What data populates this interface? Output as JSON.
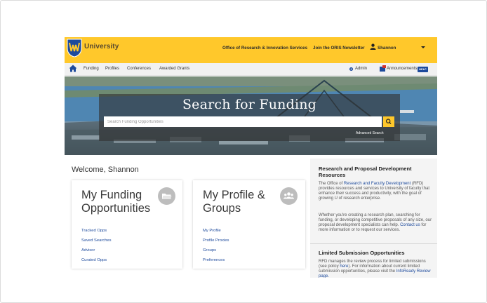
{
  "header": {
    "brand": "University",
    "links": [
      "Office of Research & Innovation Services",
      "Join the ORIS Newsletter"
    ],
    "user_name": "Shannon"
  },
  "nav": {
    "items": [
      "Funding",
      "Profiles",
      "Conferences",
      "Awarded Grants"
    ],
    "admin": "Admin",
    "announcements": "Announcements",
    "help": "HELP"
  },
  "hero": {
    "title": "Search for Funding",
    "search_placeholder": "Search Funding Opportunities",
    "advanced_search": "Advanced Search"
  },
  "welcome": "Welcome, Shannon",
  "cards": [
    {
      "title_line1": "My Funding",
      "title_line2": "Opportunities",
      "icon": "folder-icon",
      "links": [
        "Tracked Opps",
        "Saved Searches",
        "Advisor",
        "Curated Opps"
      ]
    },
    {
      "title_line1": "My Profile &",
      "title_line2": "Groups",
      "icon": "group-icon",
      "links": [
        "My Profile",
        "Profile Proxies",
        "Groups",
        "Preferences"
      ]
    }
  ],
  "sidebar": {
    "section1": {
      "title": "Research and Proposal Development Resources",
      "p1_before": "The Office of ",
      "p1_link": "Research and Faculty Development",
      "p1_after": " (RFD) provides resources and services to University of faculty that enhance their success and productivity, with the goal of growing U of research enterprise.",
      "p2_before": "Whether you're creating a research plan, searching for funding, or developing competitive proposals of any size, our proposal development specialists can help. ",
      "p2_link": "Contact us",
      "p2_after": " for more information or to request our services."
    },
    "section2": {
      "title": "Limited Submission Opportunities",
      "p1_before": "RFD manages the review process for limited submissions (see policy ",
      "p1_link": "here",
      "p1_after": "). For information about current limited submission opportunities, please visit the ",
      "p1_link2": "InfoReady Review page."
    }
  },
  "colors": {
    "header_yellow": "#ffc82b",
    "link_blue": "#1d4a9c",
    "help_badge": "#1d4a9c"
  }
}
